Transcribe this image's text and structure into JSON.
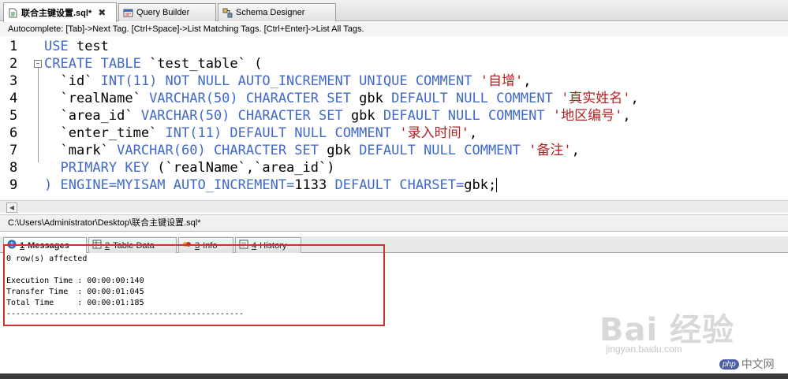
{
  "tabs": [
    {
      "label": "联合主键设置.sql*",
      "icon": "sql-file-icon",
      "active": true,
      "closable": true
    },
    {
      "label": "Query Builder",
      "icon": "query-builder-icon",
      "active": false
    },
    {
      "label": "Schema Designer",
      "icon": "schema-designer-icon",
      "active": false
    }
  ],
  "autocomplete_hint": "Autocomplete: [Tab]->Next Tag. [Ctrl+Space]->List Matching Tags. [Ctrl+Enter]->List All Tags.",
  "editor": {
    "line_numbers": [
      "1",
      "2",
      "3",
      "4",
      "5",
      "6",
      "7",
      "8",
      "9"
    ],
    "lines": [
      [
        {
          "t": "USE",
          "c": "kw"
        },
        {
          "t": " test",
          "c": ""
        }
      ],
      [
        {
          "t": "CREATE TABLE",
          "c": "kw"
        },
        {
          "t": " `test_table` (",
          "c": ""
        }
      ],
      [
        {
          "t": "  `id` ",
          "c": ""
        },
        {
          "t": "INT(11) NOT NULL AUTO_INCREMENT UNIQUE COMMENT ",
          "c": "kw"
        },
        {
          "t": "'自增'",
          "c": "str"
        },
        {
          "t": ",",
          "c": ""
        }
      ],
      [
        {
          "t": "  `realName` ",
          "c": ""
        },
        {
          "t": "VARCHAR(50) CHARACTER SET",
          "c": "kw"
        },
        {
          "t": " gbk ",
          "c": ""
        },
        {
          "t": "DEFAULT NULL COMMENT ",
          "c": "kw"
        },
        {
          "t": "'真实姓名'",
          "c": "str"
        },
        {
          "t": ",",
          "c": ""
        }
      ],
      [
        {
          "t": "  `area_id` ",
          "c": ""
        },
        {
          "t": "VARCHAR(50) CHARACTER SET",
          "c": "kw"
        },
        {
          "t": " gbk ",
          "c": ""
        },
        {
          "t": "DEFAULT NULL COMMENT ",
          "c": "kw"
        },
        {
          "t": "'地区编号'",
          "c": "str"
        },
        {
          "t": ",",
          "c": ""
        }
      ],
      [
        {
          "t": "  `enter_time` ",
          "c": ""
        },
        {
          "t": "INT(11) DEFAULT NULL COMMENT ",
          "c": "kw"
        },
        {
          "t": "'录入时间'",
          "c": "str"
        },
        {
          "t": ",",
          "c": ""
        }
      ],
      [
        {
          "t": "  `mark` ",
          "c": ""
        },
        {
          "t": "VARCHAR(60) CHARACTER SET",
          "c": "kw"
        },
        {
          "t": " gbk ",
          "c": ""
        },
        {
          "t": "DEFAULT NULL COMMENT ",
          "c": "kw"
        },
        {
          "t": "'备注'",
          "c": "str"
        },
        {
          "t": ",",
          "c": ""
        }
      ],
      [
        {
          "t": "  PRIMARY KEY",
          "c": "kw"
        },
        {
          "t": " (`realName`,`area_id`)",
          "c": ""
        }
      ],
      [
        {
          "t": ") ",
          "c": "kw"
        },
        {
          "t": "ENGINE=MYISAM AUTO_INCREMENT=",
          "c": "kw"
        },
        {
          "t": "1133",
          "c": ""
        },
        {
          "t": " DEFAULT CHARSET=",
          "c": "kw"
        },
        {
          "t": "gbk;",
          "c": ""
        }
      ]
    ]
  },
  "file_path": "C:\\Users\\Administrator\\Desktop\\联合主键设置.sql*",
  "result_tabs": [
    {
      "num": "1",
      "label": " Messages",
      "icon": "messages-icon",
      "active": true
    },
    {
      "num": "2",
      "label": " Table Data",
      "icon": "table-data-icon",
      "active": false
    },
    {
      "num": "3",
      "label": " Info",
      "icon": "info-icon",
      "active": false
    },
    {
      "num": "4",
      "label": " History",
      "icon": "history-icon",
      "active": false
    }
  ],
  "messages": {
    "affected": "0 row(s) affected",
    "execution_time": "Execution Time : 00:00:00:140",
    "transfer_time": "Transfer Time  : 00:00:01:045",
    "total_time": "Total Time     : 00:00:01:185",
    "separator": "--------------------------------------------------"
  },
  "watermark": {
    "baidu": "Bai 经验",
    "url": "jingyan.baidu.com",
    "php_badge": "php",
    "php_text": "中文网"
  },
  "colors": {
    "keyword": "#4169c8",
    "string": "#b22222",
    "highlight_box": "#d0312d"
  }
}
